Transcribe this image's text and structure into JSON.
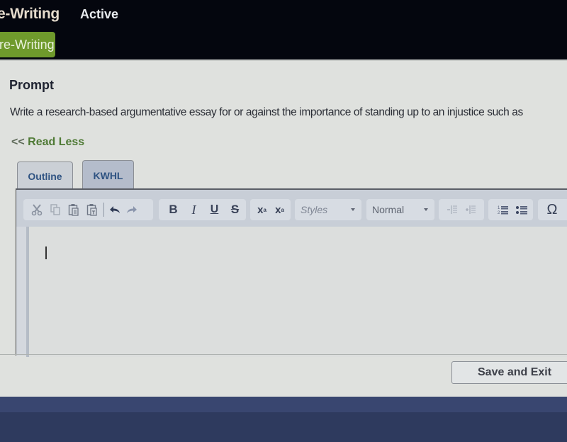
{
  "header": {
    "app_title": "e-Writing",
    "status": "Active",
    "stage_tab": "re-Writing"
  },
  "prompt": {
    "heading": "Prompt",
    "text": "Write a research-based argumentative essay for or against the importance of standing up to an injustice such as",
    "read_less_arrows": "<<",
    "read_less_label": "Read Less"
  },
  "tabs": [
    {
      "label": "Outline",
      "active": false
    },
    {
      "label": "KWHL",
      "active": true
    }
  ],
  "toolbar": {
    "clipboard": [
      "cut-icon",
      "copy-icon",
      "paste-icon",
      "paste-text-icon"
    ],
    "history": [
      "undo-icon",
      "redo-icon"
    ],
    "basic_styles": {
      "bold": "B",
      "italic": "I",
      "underline": "U",
      "strike": "S"
    },
    "subscript": "x",
    "subscript_mark": "a",
    "superscript": "x",
    "superscript_mark": "a",
    "styles_dropdown": {
      "value": "Styles"
    },
    "format_dropdown": {
      "value": "Normal"
    },
    "indent": [
      "outdent-icon",
      "indent-icon"
    ],
    "lists": [
      "numbered-list-icon",
      "bulleted-list-icon"
    ],
    "special_char": "Ω"
  },
  "editor": {
    "content": ""
  },
  "actions": {
    "save_exit": "Save and Exit"
  },
  "colors": {
    "header_bg": "#04060e",
    "stage_tab_bg": "#6f9a2c",
    "read_less": "#4f7a35",
    "tab_text": "#2f5382",
    "panel_bg": "#dfe1de"
  }
}
